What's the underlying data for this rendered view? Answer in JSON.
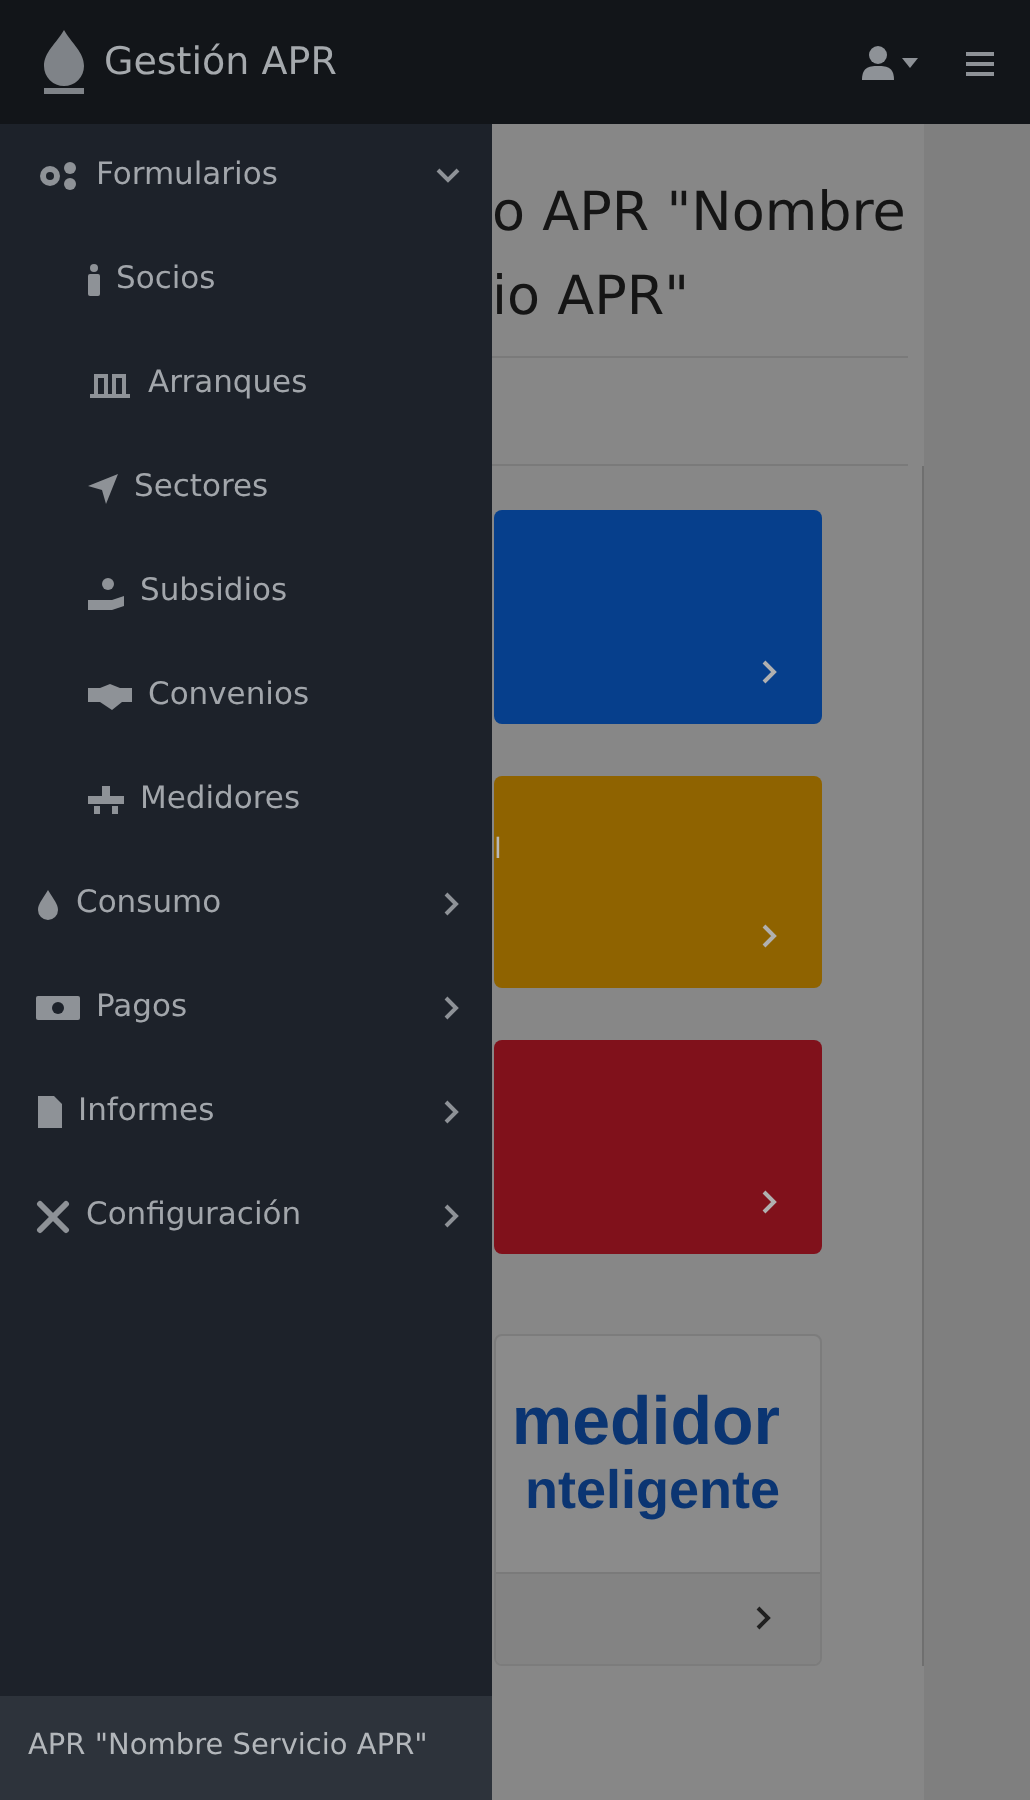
{
  "navbar": {
    "brand": "Gestión APR"
  },
  "sidebar": {
    "items": [
      {
        "label": "Formularios",
        "expanded": true,
        "children": [
          {
            "label": "Socios"
          },
          {
            "label": "Arranques"
          },
          {
            "label": "Sectores"
          },
          {
            "label": "Subsidios"
          },
          {
            "label": "Convenios"
          },
          {
            "label": "Medidores"
          }
        ]
      },
      {
        "label": "Consumo",
        "expanded": false
      },
      {
        "label": "Pagos",
        "expanded": false
      },
      {
        "label": "Informes",
        "expanded": false
      },
      {
        "label": "Configuración",
        "expanded": false
      }
    ],
    "footer": "APR \"Nombre Servicio APR\""
  },
  "content": {
    "heading_lines": [
      "o APR \"Nombre",
      "io APR\""
    ],
    "cards": [
      {
        "kind": "colored",
        "color": "#063f8c"
      },
      {
        "kind": "colored",
        "color": "#8f6300",
        "text": "l"
      },
      {
        "kind": "colored",
        "color": "#80111b"
      },
      {
        "kind": "logo",
        "lines": [
          "medidor",
          "nteligente"
        ]
      }
    ]
  }
}
